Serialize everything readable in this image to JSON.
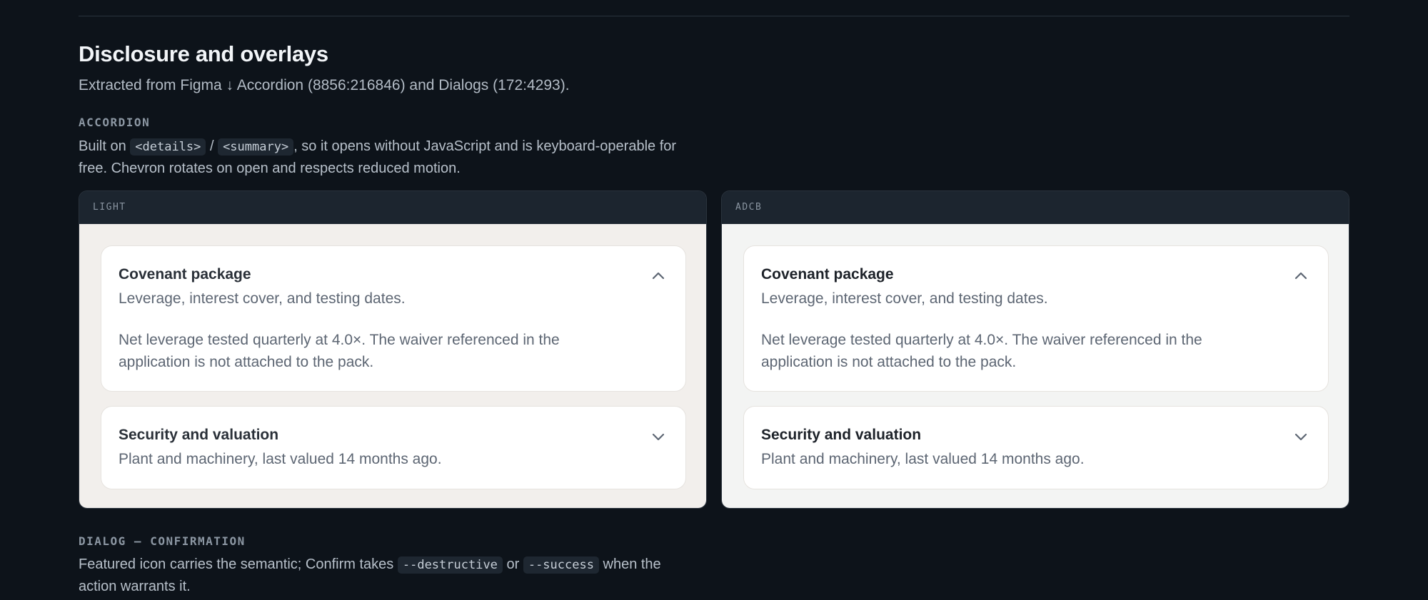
{
  "section": {
    "title": "Disclosure and overlays",
    "subtitle": "Extracted from Figma ↓ Accordion (8856:216846) and Dialogs (172:4293)."
  },
  "accordion_block": {
    "eyebrow": "ACCORDION",
    "desc_pre": "Built on ",
    "code_details": "<details>",
    "desc_sep": " / ",
    "code_summary": "<summary>",
    "desc_line1_post": ", so it opens without JavaScript and is keyboard-operable for",
    "desc_line2": "free. Chevron rotates on open and respects reduced motion."
  },
  "panels": [
    {
      "label": "LIGHT",
      "items": [
        {
          "title": "Covenant package",
          "subtitle": "Leverage, interest cover, and testing dates.",
          "body": "Net leverage tested quarterly at 4.0×. The waiver referenced in the application is not attached to the pack.",
          "open": true
        },
        {
          "title": "Security and valuation",
          "subtitle": "Plant and machinery, last valued 14 months ago.",
          "open": false
        }
      ]
    },
    {
      "label": "ADCB",
      "items": [
        {
          "title": "Covenant package",
          "subtitle": "Leverage, interest cover, and testing dates.",
          "body": "Net leverage tested quarterly at 4.0×. The waiver referenced in the application is not attached to the pack.",
          "open": true
        },
        {
          "title": "Security and valuation",
          "subtitle": "Plant and machinery, last valued 14 months ago.",
          "open": false
        }
      ]
    }
  ],
  "dialog_block": {
    "eyebrow": "DIALOG — CONFIRMATION",
    "desc_pre": "Featured icon carries the semantic; Confirm takes ",
    "code_destructive": "--destructive",
    "desc_or": " or ",
    "code_success": "--success",
    "desc_line1_post": " when the",
    "desc_line2": "action warrants it."
  },
  "icons": {
    "chevron_up": "chevron-up-icon",
    "chevron_down": "chevron-down-icon"
  }
}
